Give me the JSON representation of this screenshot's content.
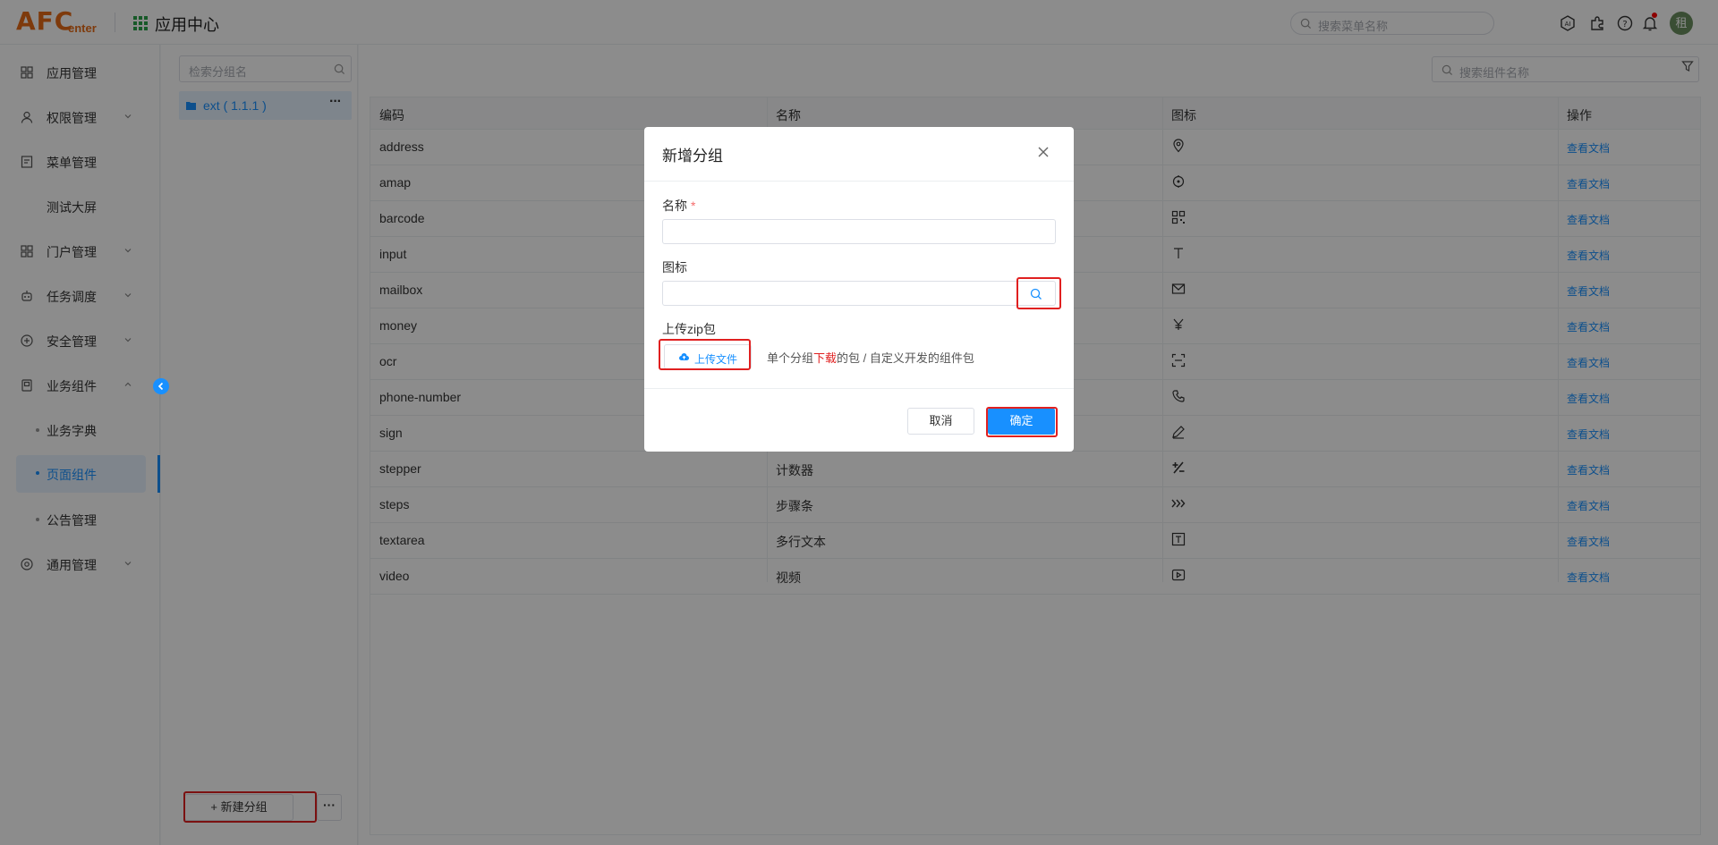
{
  "header": {
    "logo_text": "AFC",
    "logo_sub": "enter",
    "app_title": "应用中心",
    "search_placeholder": "搜索菜单名称",
    "avatar_text": "租",
    "icons": [
      "ai-icon",
      "plugin-icon",
      "help-icon",
      "bell-icon"
    ]
  },
  "sidebar": {
    "items": [
      {
        "label": "应用管理",
        "icon": "grid-icon"
      },
      {
        "label": "权限管理",
        "icon": "user-icon",
        "expandable": true
      },
      {
        "label": "菜单管理",
        "icon": "menu-icon"
      },
      {
        "label": "测试大屏"
      },
      {
        "label": "门户管理",
        "icon": "portal-icon",
        "expandable": true
      },
      {
        "label": "任务调度",
        "icon": "robot-icon",
        "expandable": true
      },
      {
        "label": "安全管理",
        "icon": "shield-icon",
        "expandable": true
      },
      {
        "label": "业务组件",
        "icon": "component-icon",
        "expanded": true
      },
      {
        "label": "业务字典",
        "sub": true
      },
      {
        "label": "页面组件",
        "sub": true,
        "active": true
      },
      {
        "label": "公告管理",
        "sub": true
      },
      {
        "label": "通用管理",
        "icon": "settings-icon",
        "expandable": true
      }
    ]
  },
  "groups": {
    "search_placeholder": "检索分组名",
    "items": [
      {
        "label": "ext ( 1.1.1 )"
      }
    ],
    "new_group_label": "+ 新建分组",
    "more_label": "···"
  },
  "components": {
    "search_placeholder": "搜索组件名称",
    "columns": [
      "编码",
      "名称",
      "图标",
      "操作"
    ],
    "rows": [
      {
        "code": "address",
        "name": "",
        "icon": "location-icon",
        "action": "查看文档"
      },
      {
        "code": "amap",
        "name": "",
        "icon": "target-icon",
        "action": "查看文档"
      },
      {
        "code": "barcode",
        "name": "",
        "icon": "qrcode-icon",
        "action": "查看文档"
      },
      {
        "code": "input",
        "name": "",
        "icon": "text-icon",
        "action": "查看文档"
      },
      {
        "code": "mailbox",
        "name": "",
        "icon": "mail-icon",
        "action": "查看文档"
      },
      {
        "code": "money",
        "name": "",
        "icon": "yen-icon",
        "action": "查看文档"
      },
      {
        "code": "ocr",
        "name": "",
        "icon": "scan-icon",
        "action": "查看文档"
      },
      {
        "code": "phone-number",
        "name": "",
        "icon": "phone-icon",
        "action": "查看文档"
      },
      {
        "code": "sign",
        "name": "",
        "icon": "pen-icon",
        "action": "查看文档"
      },
      {
        "code": "stepper",
        "name": "计数器",
        "icon": "plus-minus-icon",
        "action": "查看文档"
      },
      {
        "code": "steps",
        "name": "步骤条",
        "icon": "steps-icon",
        "action": "查看文档"
      },
      {
        "code": "textarea",
        "name": "多行文本",
        "icon": "textarea-icon",
        "action": "查看文档"
      },
      {
        "code": "video",
        "name": "视频",
        "icon": "video-icon",
        "action": "查看文档"
      }
    ]
  },
  "dialog": {
    "title": "新增分组",
    "name_label": "名称",
    "required_mark": "*",
    "name_value": "",
    "icon_label": "图标",
    "icon_value": "",
    "zip_label": "上传zip包",
    "upload_label": "上传文件",
    "tip_before": "单个分组",
    "tip_link": "下载",
    "tip_after": "的包 / 自定义开发的组件包",
    "cancel_label": "取消",
    "ok_label": "确定"
  },
  "colors": {
    "brand": "#e56b16",
    "primary": "#1890ff",
    "highlight": "#e02020"
  }
}
